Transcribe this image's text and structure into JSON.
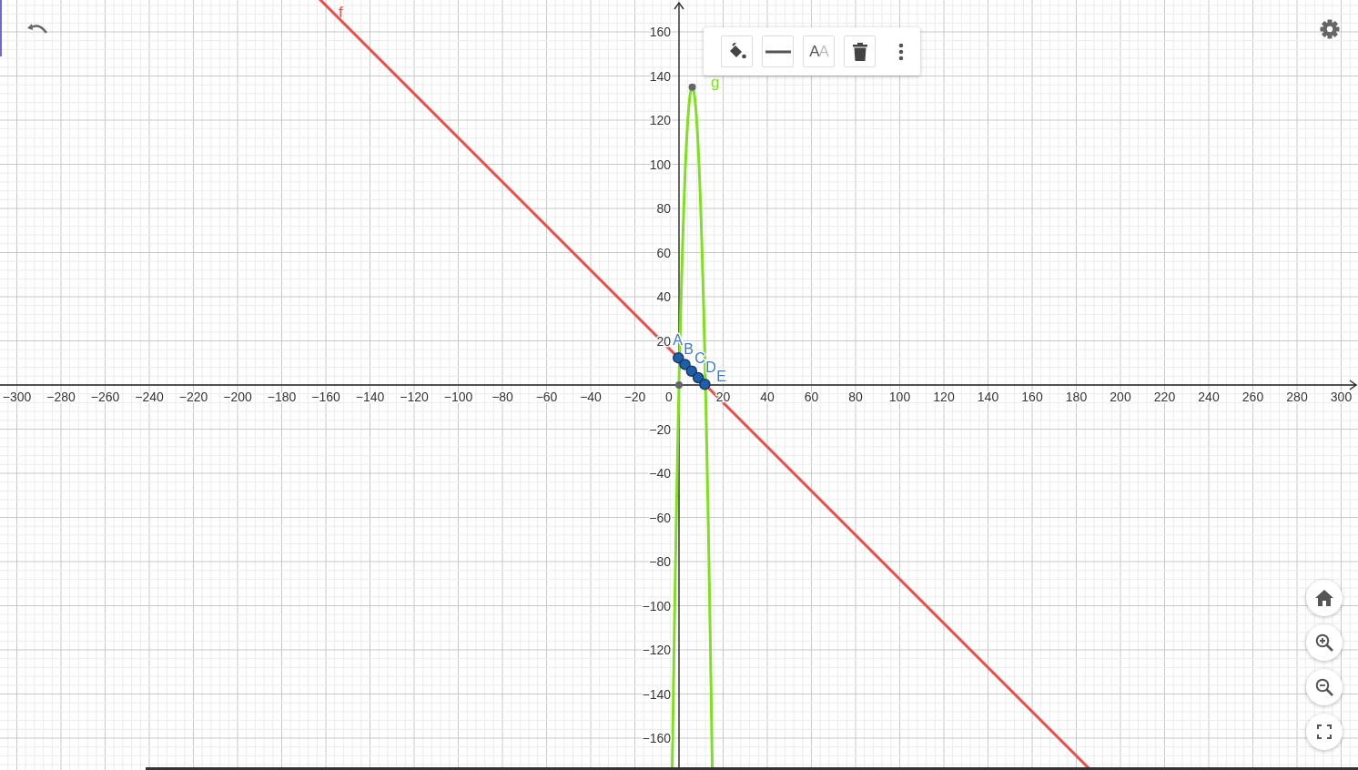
{
  "graph": {
    "x_tick_labels": [
      "−300",
      "−280",
      "−260",
      "−240",
      "−220",
      "−200",
      "−180",
      "−160",
      "−140",
      "−120",
      "−100",
      "−80",
      "−60",
      "−40",
      "−20",
      "0",
      "20",
      "40",
      "60",
      "80",
      "100",
      "120",
      "140",
      "160",
      "180",
      "200",
      "220",
      "240",
      "260",
      "280",
      "300"
    ],
    "y_tick_labels": [
      "160",
      "140",
      "120",
      "100",
      "80",
      "60",
      "40",
      "20",
      "−20",
      "−40",
      "−60",
      "−80",
      "−100",
      "−120",
      "−140",
      "−160"
    ],
    "functions": [
      {
        "label": "f",
        "kind": "line",
        "color": "#e8504c"
      },
      {
        "label": "g",
        "kind": "parabola",
        "color": "#80e020"
      }
    ],
    "points": [
      {
        "label": "A"
      },
      {
        "label": "B"
      },
      {
        "label": "C"
      },
      {
        "label": "D"
      },
      {
        "label": "E"
      }
    ]
  },
  "style_bar": {
    "text_style_button": "AA"
  }
}
